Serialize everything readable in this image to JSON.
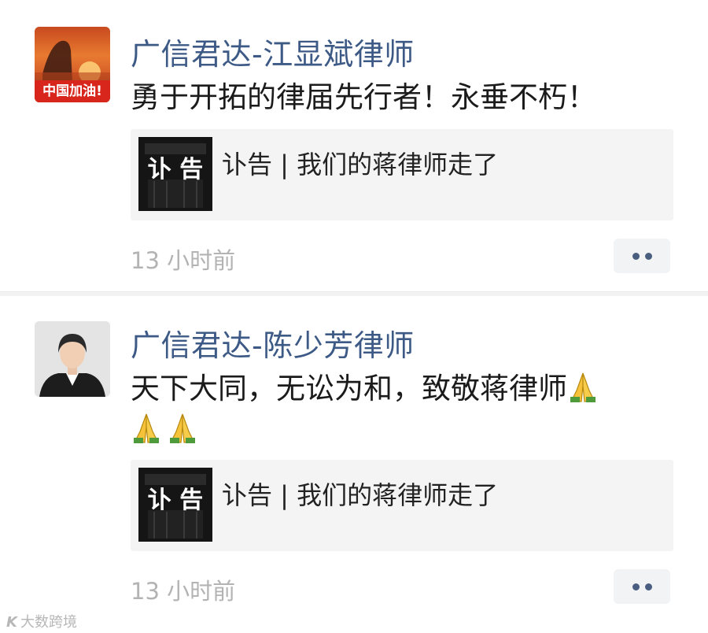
{
  "posts": [
    {
      "author": "广信君达-江显斌律师",
      "avatar_badge": "中国加油!",
      "content_lines": [
        "勇于开拓的律届先行者！永垂不朽！"
      ],
      "link_card": {
        "thumb_text": "讣 告",
        "title": "讣告 | 我们的蒋律师走了"
      },
      "time": "13 小时前"
    },
    {
      "author": "广信君达-陈少芳律师",
      "content_lines": [
        "天下大同，无讼为和，致敬蒋律师",
        ""
      ],
      "emoji": "praying-hands",
      "link_card": {
        "thumb_text": "讣 告",
        "title": "讣告 | 我们的蒋律师走了"
      },
      "time": "13 小时前"
    }
  ],
  "watermark": {
    "logo": "K",
    "text": "大数跨境"
  },
  "colors": {
    "author_name": "#3d5a86",
    "time": "#b3b3b3",
    "card_bg": "#f4f4f4",
    "divider": "#f2f2f2"
  }
}
